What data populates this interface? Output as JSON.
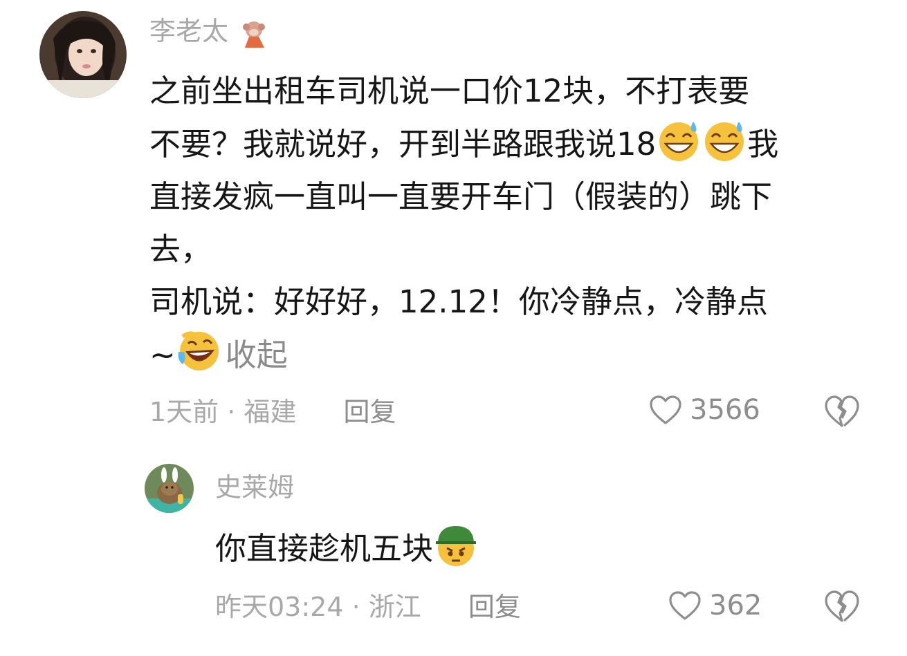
{
  "comment": {
    "username": "李老太",
    "text_lines": [
      "之前坐出租车司机说一口价12块，不打表要",
      "不要？我就说好，开到半路跟我说18",
      "我",
      "直接发疯一直叫一直要开车门（假装的）跳下",
      "去，",
      "司机说：好好好，12.12！你冷静点，冷静点",
      "~"
    ],
    "emojis": [
      "sweat-grin-emoji",
      "sweat-grin-emoji",
      "laugh-cry-emoji"
    ],
    "collapse_label": "收起",
    "time": "1天前",
    "location": "福建",
    "reply_label": "回复",
    "likes": "3566"
  },
  "reply": {
    "username": "史莱姆",
    "text": "你直接趁机五块",
    "emoji": "helmet-angry-emoji",
    "time": "昨天03:24",
    "location": "浙江",
    "reply_label": "回复",
    "likes": "362"
  },
  "icons": {
    "like": "heart-outline-icon",
    "dislike": "broken-heart-icon",
    "badge": "monkey-badge-icon"
  }
}
